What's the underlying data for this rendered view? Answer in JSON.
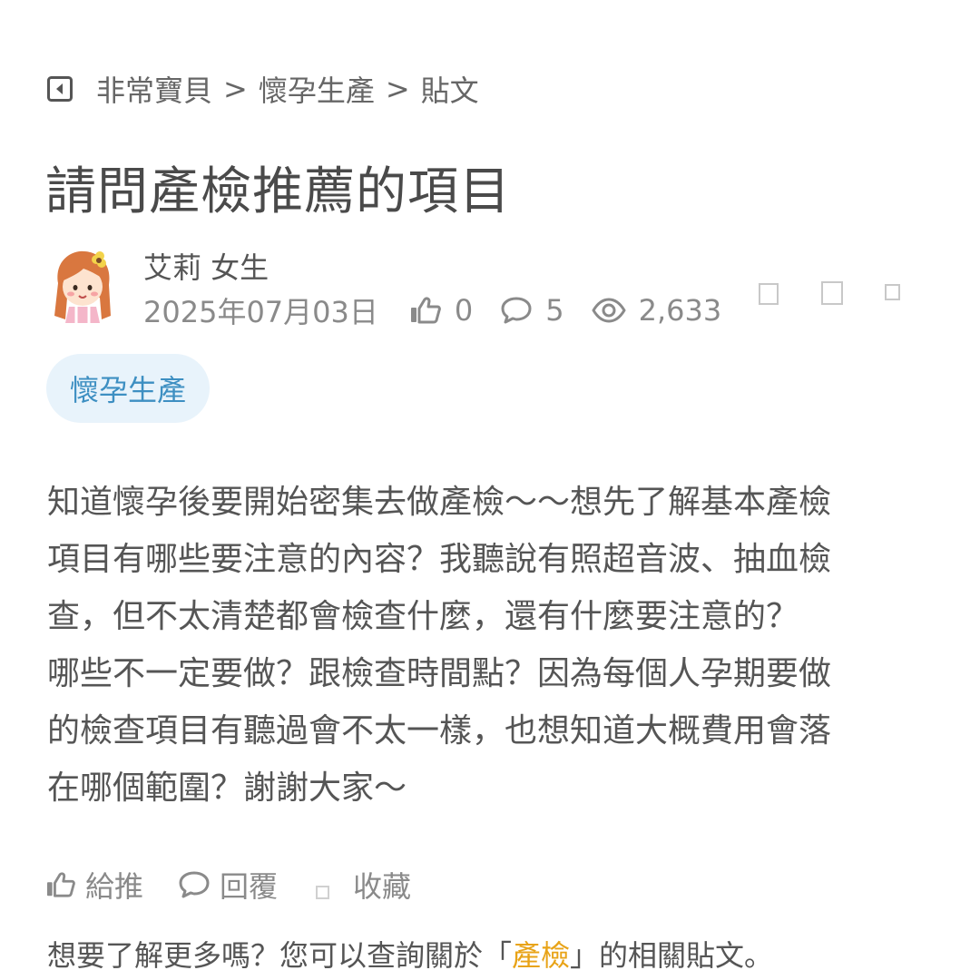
{
  "breadcrumb": {
    "items": [
      "非常寶貝",
      "懷孕生產",
      "貼文"
    ],
    "separator": ">"
  },
  "post": {
    "title": "請問產檢推薦的項目",
    "author": "艾莉 女生",
    "date": "2025年07月03日",
    "likes": "0",
    "comments": "5",
    "views": "2,633",
    "tag": "懷孕生產",
    "body_lines": [
      "知道懷孕後要開始密集去做產檢～～想先了解基本產檢",
      "項目有哪些要注意的內容？我聽說有照超音波、抽血檢",
      "查，但不太清楚都會檢查什麼，還有什麼要注意的？",
      "哪些不一定要做？跟檢查時間點？因為每個人孕期要做",
      "的檢查項目有聽過會不太一樣，也想知道大概費用會落",
      "在哪個範圍？謝謝大家～"
    ]
  },
  "actions": {
    "like": "給推",
    "reply": "回覆",
    "favorite": "收藏"
  },
  "related": {
    "prefix": "想要了解更多嗎？您可以查詢關於「",
    "keyword": "產檢",
    "suffix": "」的相關貼文。"
  },
  "colors": {
    "tag_bg": "#e8f3fb",
    "tag_text": "#3d8fc2",
    "keyword": "#e8a317",
    "meta_text": "#8a8a8a"
  },
  "icons": {
    "back": "back-arrow-icon",
    "like": "thumbs-up-icon",
    "comment": "speech-bubble-icon",
    "views": "eye-icon",
    "avatar": "cartoon-girl-avatar"
  }
}
